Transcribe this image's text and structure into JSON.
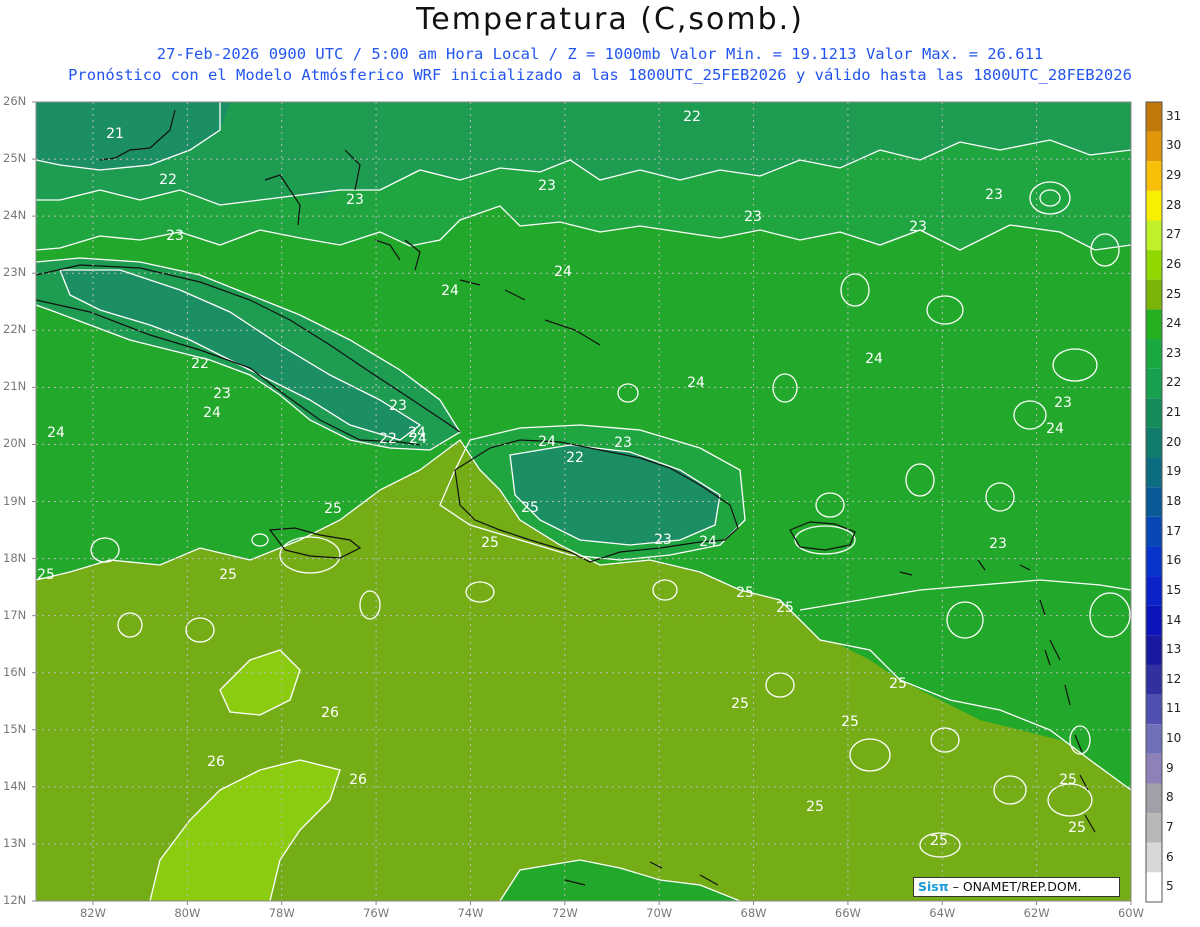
{
  "title": "Temperatura (C,somb.)",
  "subtitle_1": "27-Feb-2026  0900 UTC / 5:00 am Hora Local / Z = 1000mb    Valor Min. = 19.1213  Valor Max. = 26.611",
  "subtitle_2": "Pronóstico con el Modelo Atmósferico WRF inicializado a las 1800UTC_25FEB2026 y válido hasta las  1800UTC_28FEB2026",
  "credit": {
    "logo": "Sisπ",
    "text": "– ONAMET/REP.DOM."
  },
  "lat_labels": [
    "26N",
    "25N",
    "24N",
    "23N",
    "22N",
    "21N",
    "20N",
    "19N",
    "18N",
    "17N",
    "16N",
    "15N",
    "14N",
    "13N",
    "12N"
  ],
  "lon_labels": [
    "82W",
    "80W",
    "78W",
    "76W",
    "74W",
    "72W",
    "70W",
    "68W",
    "66W",
    "64W",
    "62W",
    "60W"
  ],
  "colorbar": {
    "levels": [
      "31",
      "30",
      "29",
      "28",
      "27",
      "26",
      "25",
      "24",
      "23",
      "22",
      "21",
      "20",
      "19",
      "18",
      "17",
      "16",
      "15",
      "14",
      "13",
      "12",
      "11",
      "10",
      "9",
      "8",
      "7",
      "6",
      "5"
    ],
    "colors": [
      "#c07808",
      "#e09608",
      "#f8c008",
      "#f8f000",
      "#c0f028",
      "#90d800",
      "#7cb408",
      "#24b020",
      "#1aa840",
      "#16a050",
      "#148c5a",
      "#107c6c",
      "#0c6c80",
      "#0a5a98",
      "#0848b4",
      "#0834cc",
      "#0a22c8",
      "#0a14b8",
      "#1818a0",
      "#3030a0",
      "#5050b0",
      "#7070b8",
      "#9080b8",
      "#a0a0a8",
      "#b8b8b8",
      "#d8d8d8",
      "#ffffff"
    ]
  },
  "field_colors": {
    "temp_21": "#1c8e64",
    "temp_22": "#1e9c52",
    "temp_23": "#1fa640",
    "temp_24": "#22a82a",
    "temp_25": "#74ad16",
    "temp_26": "#8ccc10"
  },
  "contour_labels": [
    "21",
    "22",
    "22",
    "22",
    "23",
    "23",
    "23",
    "23",
    "24",
    "24",
    "24",
    "22",
    "23",
    "23",
    "23",
    "23",
    "24",
    "24",
    "24",
    "24",
    "25",
    "25",
    "25",
    "25",
    "25",
    "25",
    "26",
    "26",
    "26",
    "25",
    "25",
    "25",
    "25",
    "24",
    "23",
    "22",
    "23",
    "25",
    "25",
    "25",
    "24",
    "23",
    "24",
    "23",
    "24",
    "25"
  ]
}
